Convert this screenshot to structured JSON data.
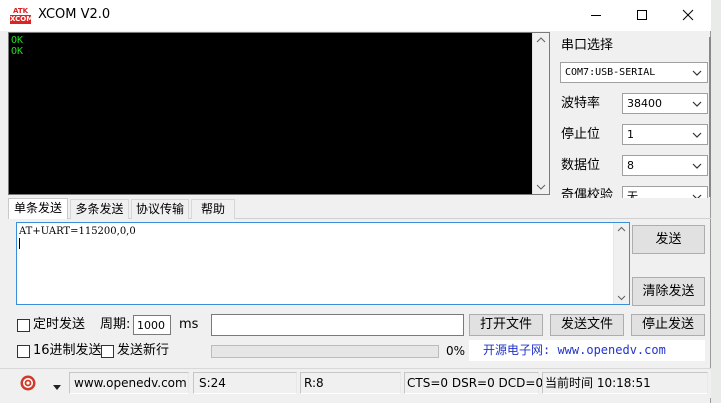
{
  "window": {
    "logo_top": "ATK",
    "logo_bottom": "XCOM",
    "title": "XCOM V2.0"
  },
  "terminal": {
    "lines": "OK\nOK"
  },
  "settings": {
    "port_section_label": "串口选择",
    "port_value": "COM7:USB-SERIAL",
    "baud_label": "波特率",
    "baud_value": "38400",
    "stop_label": "停止位",
    "stop_value": "1",
    "data_label": "数据位",
    "data_value": "8",
    "parity_label": "奇偶校验",
    "parity_value": "无"
  },
  "tabs": [
    "单条发送",
    "多条发送",
    "协议传输",
    "帮助"
  ],
  "send_text": "AT+UART=115200,0,0",
  "buttons": {
    "send": "发送",
    "clear_send": "清除发送",
    "open_file": "打开文件",
    "send_file": "发送文件",
    "stop_send": "停止发送"
  },
  "options": {
    "timed_send": "定时发送",
    "period_label": "周期:",
    "period_value": "1000",
    "period_unit": "ms",
    "hex_send": "16进制发送",
    "send_newline": "发送新行",
    "progress_label": "0%",
    "progress": 0,
    "file_path": ""
  },
  "promo": {
    "text": "开源电子网: www.openedv.com"
  },
  "statusbar": {
    "url": "www.openedv.com",
    "sent": "S:24",
    "received": "R:8",
    "signals": "CTS=0 DSR=0 DCD=0",
    "time": "当前时间 10:18:51"
  },
  "colors": {
    "terminal_bg": "#000000",
    "terminal_text": "#22dd22",
    "link": "#2233cc",
    "textarea_border": "#3c8fd6",
    "gear": "#d03a2a"
  },
  "icons": {
    "minimize": "minimize-icon",
    "maximize": "maximize-icon",
    "close": "close-icon",
    "dropdown": "chevron-down-icon",
    "settings": "gear-icon"
  }
}
